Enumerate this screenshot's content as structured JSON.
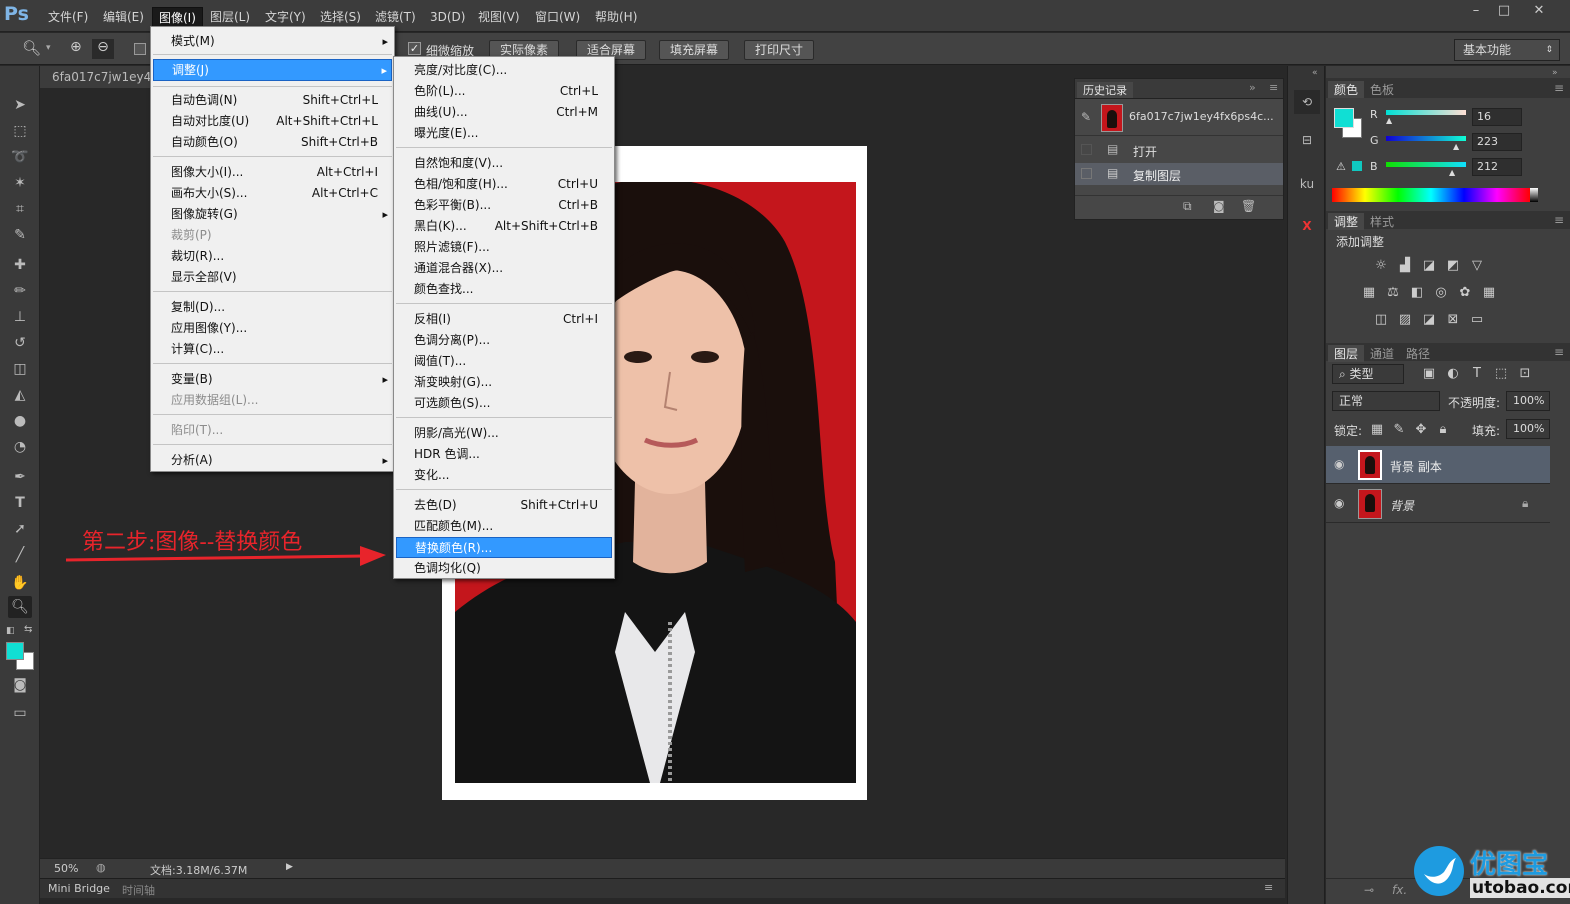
{
  "app": {
    "logo": "Ps"
  },
  "menubar": {
    "items": [
      "文件(F)",
      "编辑(E)",
      "图像(I)",
      "图层(L)",
      "文字(Y)",
      "选择(S)",
      "滤镜(T)",
      "3D(D)",
      "视图(V)",
      "窗口(W)",
      "帮助(H)"
    ],
    "active": "图像(I)"
  },
  "window_controls": [
    "–",
    "□",
    "✕"
  ],
  "options_bar": {
    "checkbox_label": "细微缩放",
    "buttons": [
      "实际像素",
      "适合屏幕",
      "填充屏幕",
      "打印尺寸"
    ],
    "workspace": "基本功能"
  },
  "document": {
    "tab_title": "6fa017c7jw1ey4fx",
    "zoom": "50%",
    "doc_size": "文档:3.18M/6.37M",
    "bottom_tabs": [
      "Mini Bridge",
      "时间轴"
    ]
  },
  "annotation": {
    "text": "第二步:图像--替换颜色"
  },
  "image_menu": {
    "items": [
      {
        "label": "模式(M)",
        "sub": true
      },
      {
        "label": "调整(J)",
        "sub": true,
        "highlight": true
      },
      {
        "label": "自动色调(N)",
        "shortcut": "Shift+Ctrl+L"
      },
      {
        "label": "自动对比度(U)",
        "shortcut": "Alt+Shift+Ctrl+L"
      },
      {
        "label": "自动颜色(O)",
        "shortcut": "Shift+Ctrl+B"
      },
      {
        "label": "图像大小(I)...",
        "shortcut": "Alt+Ctrl+I"
      },
      {
        "label": "画布大小(S)...",
        "shortcut": "Alt+Ctrl+C"
      },
      {
        "label": "图像旋转(G)",
        "sub": true
      },
      {
        "label": "裁剪(P)",
        "disabled": true
      },
      {
        "label": "裁切(R)..."
      },
      {
        "label": "显示全部(V)"
      },
      {
        "label": "复制(D)..."
      },
      {
        "label": "应用图像(Y)..."
      },
      {
        "label": "计算(C)..."
      },
      {
        "label": "变量(B)",
        "sub": true
      },
      {
        "label": "应用数据组(L)...",
        "disabled": true
      },
      {
        "label": "陷印(T)...",
        "disabled": true
      },
      {
        "label": "分析(A)",
        "sub": true
      }
    ]
  },
  "adjust_menu": {
    "items": [
      {
        "label": "亮度/对比度(C)..."
      },
      {
        "label": "色阶(L)...",
        "shortcut": "Ctrl+L"
      },
      {
        "label": "曲线(U)...",
        "shortcut": "Ctrl+M"
      },
      {
        "label": "曝光度(E)..."
      },
      {
        "label": "自然饱和度(V)..."
      },
      {
        "label": "色相/饱和度(H)...",
        "shortcut": "Ctrl+U"
      },
      {
        "label": "色彩平衡(B)...",
        "shortcut": "Ctrl+B"
      },
      {
        "label": "黑白(K)...",
        "shortcut": "Alt+Shift+Ctrl+B"
      },
      {
        "label": "照片滤镜(F)..."
      },
      {
        "label": "通道混合器(X)..."
      },
      {
        "label": "颜色查找..."
      },
      {
        "label": "反相(I)",
        "shortcut": "Ctrl+I"
      },
      {
        "label": "色调分离(P)..."
      },
      {
        "label": "阈值(T)..."
      },
      {
        "label": "渐变映射(G)..."
      },
      {
        "label": "可选颜色(S)..."
      },
      {
        "label": "阴影/高光(W)..."
      },
      {
        "label": "HDR 色调..."
      },
      {
        "label": "变化..."
      },
      {
        "label": "去色(D)",
        "shortcut": "Shift+Ctrl+U"
      },
      {
        "label": "匹配颜色(M)..."
      },
      {
        "label": "替换颜色(R)...",
        "highlight": true
      },
      {
        "label": "色调均化(Q)"
      }
    ]
  },
  "history_panel": {
    "tab": "历史记录",
    "snapshot": "6fa017c7jw1ey4fx6ps4c...",
    "states": [
      "打开",
      "复制图层"
    ]
  },
  "color_panel": {
    "tabs": [
      "颜色",
      "色板"
    ],
    "channels": [
      {
        "label": "R",
        "value": "16"
      },
      {
        "label": "G",
        "value": "223"
      },
      {
        "label": "B",
        "value": "212"
      }
    ],
    "fg_color": "#10dfd4"
  },
  "adjustments_panel": {
    "tabs": [
      "调整",
      "样式"
    ],
    "title": "添加调整"
  },
  "layers_panel": {
    "tabs": [
      "图层",
      "通道",
      "路径"
    ],
    "filter": "类型",
    "blend_mode": "正常",
    "opacity_label": "不透明度:",
    "opacity": "100%",
    "lock_label": "锁定:",
    "fill_label": "填充:",
    "fill": "100%",
    "layers": [
      "背景 副本",
      "背景"
    ]
  },
  "watermark": {
    "cn": "优图宝",
    "url": "utobao.com"
  }
}
